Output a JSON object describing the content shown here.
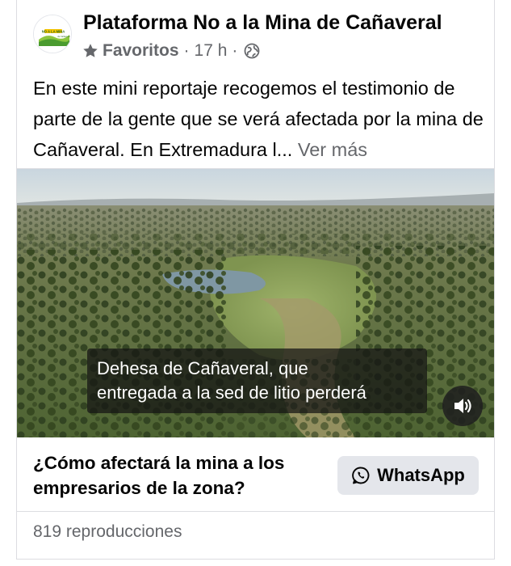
{
  "post": {
    "page_name": "Plataforma No a la Mina de Cañaveral",
    "favorites_label": "Favoritos",
    "separator": "·",
    "time": "17 h",
    "text": "En este mini reportaje recogemos el testimonio de parte de la gente que se verá afectada por la mina de Cañaveral. En Extremadura l...",
    "see_more": "Ver más"
  },
  "avatar": {
    "logo_text": "NO A LA MINA",
    "logo_subtext": "de Cañaveral"
  },
  "video": {
    "caption_line1": "Dehesa de Cañaveral,  que",
    "caption_line2": "entregada a la sed de litio perderá"
  },
  "cta": {
    "title": "¿Cómo afectará la mina a los empresarios de la zona?",
    "button_label": "WhatsApp"
  },
  "stats": {
    "views": "819 reproducciones"
  },
  "colors": {
    "secondary_text": "#65676b",
    "button_bg": "#e4e6eb",
    "border": "#dcdde1"
  },
  "icons": [
    "star-icon",
    "globe-icon",
    "volume-icon",
    "whatsapp-icon"
  ]
}
